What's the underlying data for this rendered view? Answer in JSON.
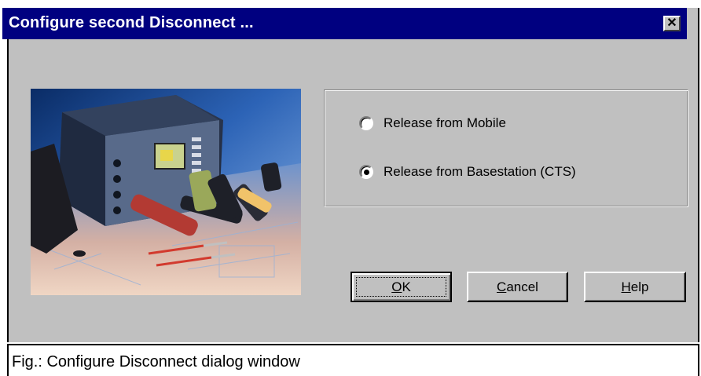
{
  "dialog": {
    "title": "Configure second Disconnect ...",
    "close_label": "✕",
    "image": {
      "description_icon": "photo-test-equipment-and-phones"
    },
    "release_group": {
      "options": [
        {
          "label": "Release from Mobile",
          "selected": false
        },
        {
          "label": "Release from Basestation (CTS)",
          "selected": true
        }
      ]
    },
    "buttons": {
      "ok": {
        "mnemonic": "O",
        "rest": "K"
      },
      "cancel": {
        "mnemonic": "C",
        "rest": "ancel"
      },
      "help": {
        "mnemonic": "H",
        "rest": "elp"
      }
    }
  },
  "caption": {
    "text": "Fig.: Configure Disconnect dialog window"
  },
  "colors": {
    "titlebar": "#000080",
    "face": "#c0c0c0"
  }
}
